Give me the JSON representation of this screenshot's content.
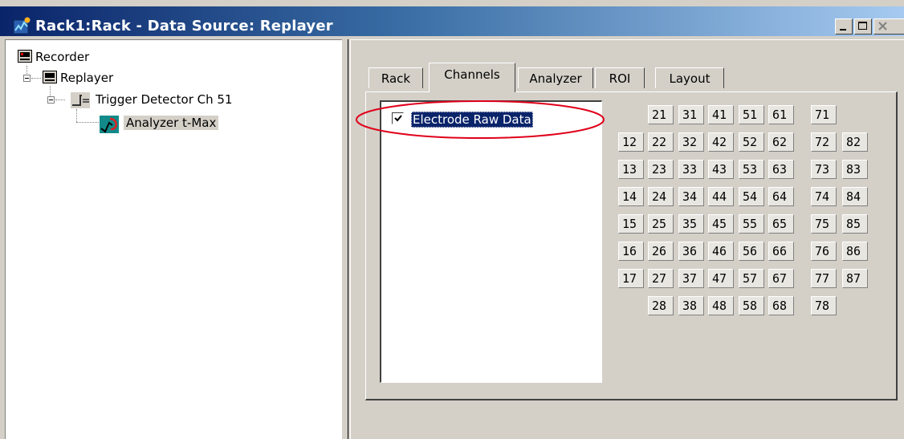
{
  "window": {
    "title": "Rack1:Rack - Data Source: Replayer"
  },
  "tree": {
    "nodes": [
      {
        "label": "Recorder",
        "icon": "recorder-icon"
      },
      {
        "label": "Replayer",
        "icon": "replayer-icon"
      },
      {
        "label": "Trigger Detector Ch 51",
        "icon": "trigger-detector-icon"
      },
      {
        "label": "Analyzer t-Max",
        "icon": "analyzer-icon",
        "selected": true
      }
    ]
  },
  "tabs": [
    {
      "label": "Rack",
      "active": false
    },
    {
      "label": "Channels",
      "active": true
    },
    {
      "label": "Analyzer",
      "active": false
    },
    {
      "label": "ROI",
      "active": false
    },
    {
      "label": "Layout",
      "active": false
    }
  ],
  "list": {
    "items": [
      {
        "label": "Electrode Raw Data",
        "checked": true,
        "selected": true
      }
    ]
  },
  "annotation": {
    "shape": "ellipse",
    "color": "#e0001a"
  },
  "channels": {
    "rows": [
      [
        "",
        "21",
        "31",
        "41",
        "51",
        "61",
        "71",
        ""
      ],
      [
        "12",
        "22",
        "32",
        "42",
        "52",
        "62",
        "72",
        "82"
      ],
      [
        "13",
        "23",
        "33",
        "43",
        "53",
        "63",
        "73",
        "83"
      ],
      [
        "14",
        "24",
        "34",
        "44",
        "54",
        "64",
        "74",
        "84"
      ],
      [
        "15",
        "25",
        "35",
        "45",
        "55",
        "65",
        "75",
        "85"
      ],
      [
        "16",
        "26",
        "36",
        "46",
        "56",
        "66",
        "76",
        "86"
      ],
      [
        "17",
        "27",
        "37",
        "47",
        "57",
        "67",
        "77",
        "87"
      ],
      [
        "",
        "28",
        "38",
        "48",
        "58",
        "68",
        "78",
        ""
      ]
    ]
  },
  "colors": {
    "title_bar": "#0a246a",
    "selection": "#0a246a",
    "annotation": "#e0001a"
  }
}
